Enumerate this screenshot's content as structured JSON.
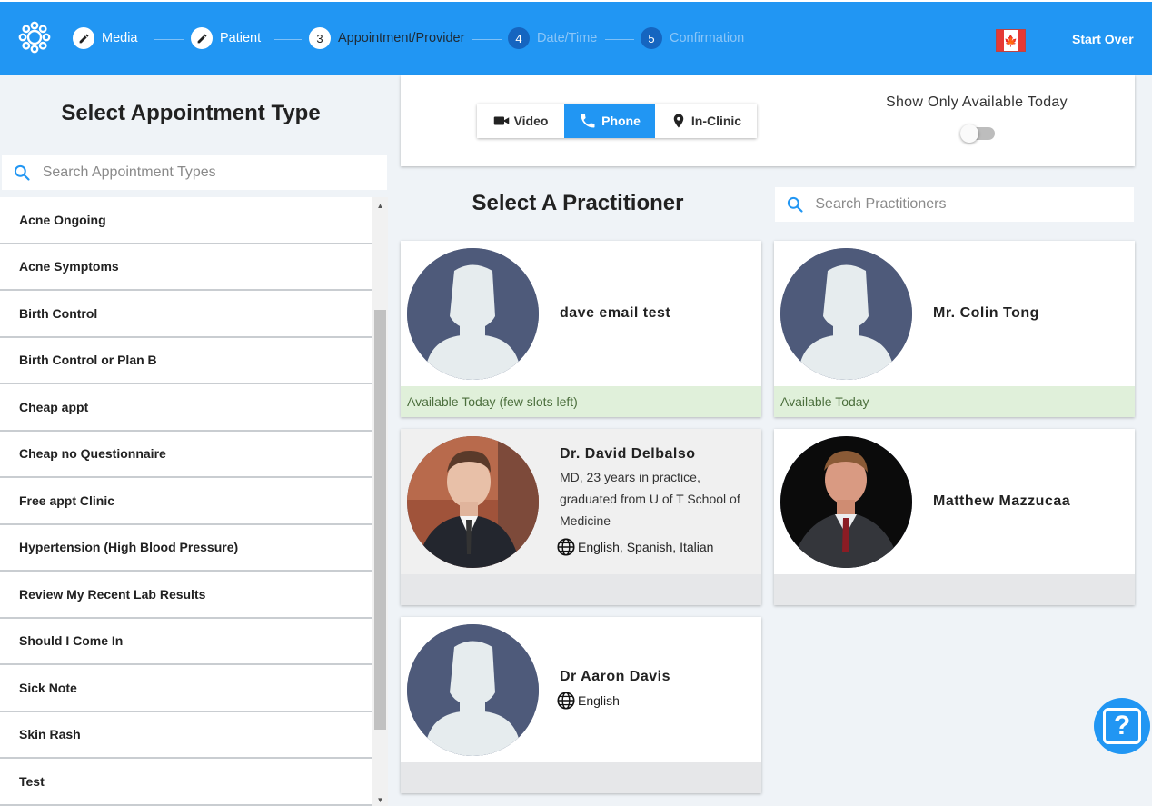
{
  "header": {
    "steps": [
      {
        "label": "Media",
        "state": "done"
      },
      {
        "label": "Patient",
        "state": "done"
      },
      {
        "label": "Appointment/Provider",
        "number": "3",
        "state": "active"
      },
      {
        "label": "Date/Time",
        "number": "4",
        "state": "pending"
      },
      {
        "label": "Confirmation",
        "number": "5",
        "state": "pending"
      }
    ],
    "start_over": "Start Over",
    "flag_icon": "canada-flag-icon",
    "accent_color": "#2196f3"
  },
  "appointment_types": {
    "title": "Select Appointment Type",
    "search_placeholder": "Search Appointment Types",
    "items": [
      "Acne Ongoing",
      "Acne Symptoms",
      "Birth Control",
      "Birth Control or Plan B",
      "Cheap appt",
      "Cheap no Questionnaire",
      "Free appt Clinic",
      "Hypertension (High Blood Pressure)",
      "Review My Recent Lab Results",
      "Should I Come In",
      "Sick Note",
      "Skin Rash",
      "Test"
    ]
  },
  "filters": {
    "modes": [
      {
        "label": "Video",
        "icon": "video-camera-icon",
        "selected": false
      },
      {
        "label": "Phone",
        "icon": "phone-icon",
        "selected": true
      },
      {
        "label": "In-Clinic",
        "icon": "location-pin-icon",
        "selected": false
      }
    ],
    "available_today_label": "Show Only Available Today",
    "available_today_on": false
  },
  "practitioners": {
    "title": "Select A Practitioner",
    "search_placeholder": "Search Practitioners",
    "cards": [
      {
        "name": "dave email test",
        "photo": "default-avatar",
        "footer": "Available Today (few slots left)",
        "available": true
      },
      {
        "name": "Mr. Colin Tong",
        "photo": "default-avatar",
        "footer": "Available Today",
        "available": true
      },
      {
        "name": "Dr. David Delbalso",
        "photo": "portrait-young-man",
        "bio": "MD, 23 years in practice, graduated from U of T School of Medicine",
        "languages": "English, Spanish, Italian",
        "footer": "",
        "available": false
      },
      {
        "name": "Matthew Mazzucaa",
        "photo": "portrait-man-suit",
        "footer": "",
        "available": false
      },
      {
        "name": "Dr Aaron Davis",
        "photo": "default-avatar",
        "languages": "English",
        "footer": "",
        "available": false
      }
    ]
  }
}
